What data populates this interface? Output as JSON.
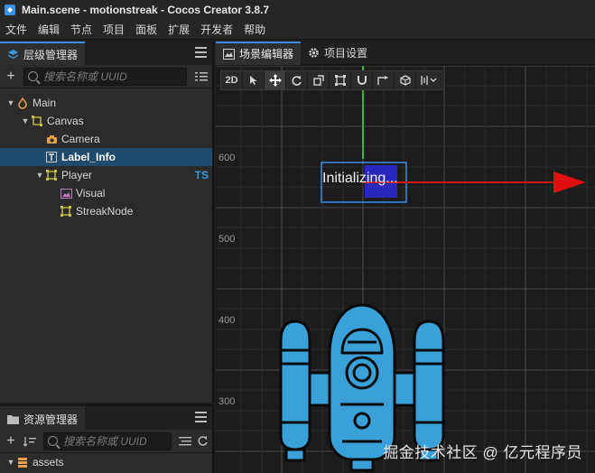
{
  "window": {
    "title": "Main.scene - motionstreak - Cocos Creator 3.8.7"
  },
  "menu": [
    "文件",
    "编辑",
    "节点",
    "项目",
    "面板",
    "扩展",
    "开发者",
    "帮助"
  ],
  "hierarchy": {
    "tab_label": "层级管理器",
    "search_placeholder": "搜索名称或 UUID",
    "nodes": [
      {
        "label": "Main",
        "icon": "scene-icon"
      },
      {
        "label": "Canvas",
        "icon": "canvas-node-icon"
      },
      {
        "label": "Camera",
        "icon": "camera-icon"
      },
      {
        "label": "Label_Info",
        "icon": "label-icon",
        "selected": true
      },
      {
        "label": "Player",
        "icon": "node-icon",
        "badge": "TS"
      },
      {
        "label": "Visual",
        "icon": "sprite-icon"
      },
      {
        "label": "StreakNode",
        "icon": "node-icon"
      }
    ]
  },
  "assets": {
    "tab_label": "资源管理器",
    "search_placeholder": "搜索名称或 UUID",
    "root": "assets"
  },
  "scene": {
    "tabs": [
      "场景编辑器",
      "项目设置"
    ],
    "mode_2d": "2D",
    "label_text": "Initializing...",
    "y_axis_labels": [
      "600",
      "500",
      "400",
      "300"
    ],
    "colors": {
      "x_axis": "#d01818",
      "y_axis": "#22c022",
      "selection": "#3a8ee6",
      "ship_body": "#3aa1d8"
    }
  },
  "watermark": "掘金技术社区 @ 亿元程序员"
}
